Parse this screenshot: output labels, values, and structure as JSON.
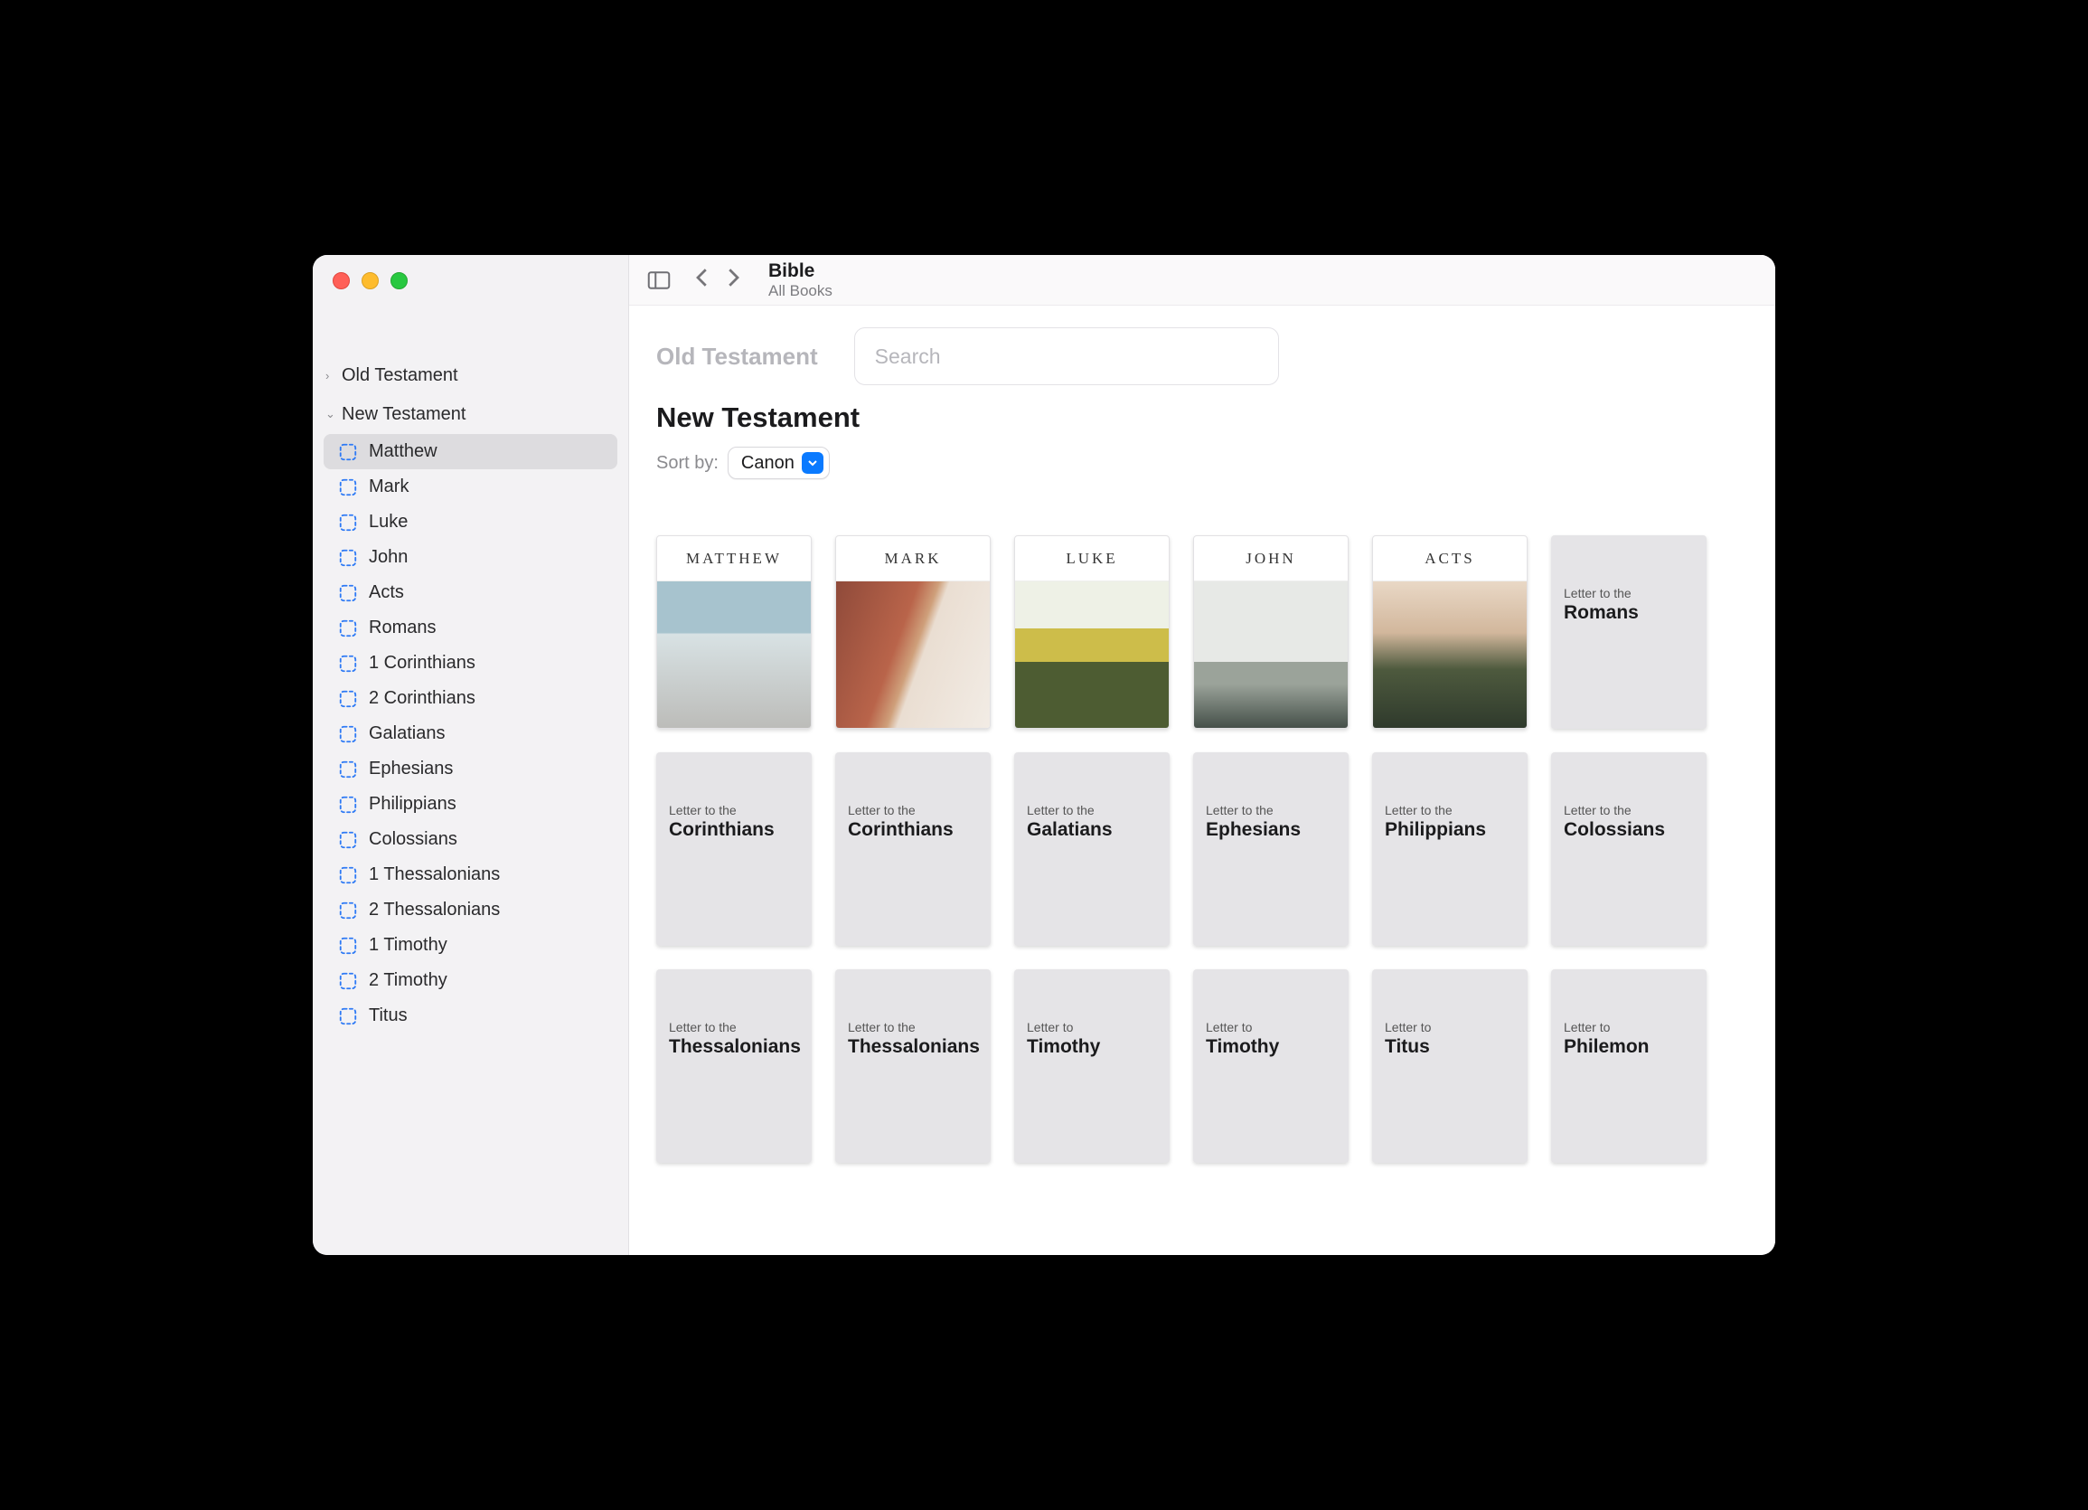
{
  "header": {
    "title": "Bible",
    "subtitle": "All Books"
  },
  "search": {
    "placeholder": "Search"
  },
  "sections": {
    "grey_label": "Old Testament",
    "current": "New Testament"
  },
  "sort": {
    "label": "Sort by:",
    "value": "Canon"
  },
  "sidebar": {
    "groups": [
      {
        "label": "Old Testament",
        "expanded": false
      },
      {
        "label": "New Testament",
        "expanded": true
      }
    ],
    "items": [
      "Matthew",
      "Mark",
      "Luke",
      "John",
      "Acts",
      "Romans",
      "1 Corinthians",
      "2 Corinthians",
      "Galatians",
      "Ephesians",
      "Philippians",
      "Colossians",
      "1 Thessalonians",
      "2 Thessalonians",
      "1 Timothy",
      "2 Timothy",
      "Titus"
    ],
    "selected": "Matthew"
  },
  "books": [
    {
      "type": "image",
      "title": "MATTHEW",
      "photo": "matthew"
    },
    {
      "type": "image",
      "title": "MARK",
      "photo": "mark"
    },
    {
      "type": "image",
      "title": "LUKE",
      "photo": "luke"
    },
    {
      "type": "image",
      "title": "JOHN",
      "photo": "john"
    },
    {
      "type": "image",
      "title": "ACTS",
      "photo": "acts"
    },
    {
      "type": "text",
      "pre": "Letter to the",
      "name": "Romans"
    },
    {
      "type": "text",
      "pre": "Letter to the",
      "name": "Corinthians"
    },
    {
      "type": "text",
      "pre": "Letter to the",
      "name": "Corinthians"
    },
    {
      "type": "text",
      "pre": "Letter to the",
      "name": "Galatians"
    },
    {
      "type": "text",
      "pre": "Letter to the",
      "name": "Ephesians"
    },
    {
      "type": "text",
      "pre": "Letter to the",
      "name": "Philippians"
    },
    {
      "type": "text",
      "pre": "Letter to the",
      "name": "Colossians"
    },
    {
      "type": "text",
      "pre": "Letter to the",
      "name": "Thessalonians"
    },
    {
      "type": "text",
      "pre": "Letter to the",
      "name": "Thessalonians"
    },
    {
      "type": "text",
      "pre": "Letter to",
      "name": "Timothy"
    },
    {
      "type": "text",
      "pre": "Letter to",
      "name": "Timothy"
    },
    {
      "type": "text",
      "pre": "Letter to",
      "name": "Titus"
    },
    {
      "type": "text",
      "pre": "Letter to",
      "name": "Philemon"
    }
  ]
}
